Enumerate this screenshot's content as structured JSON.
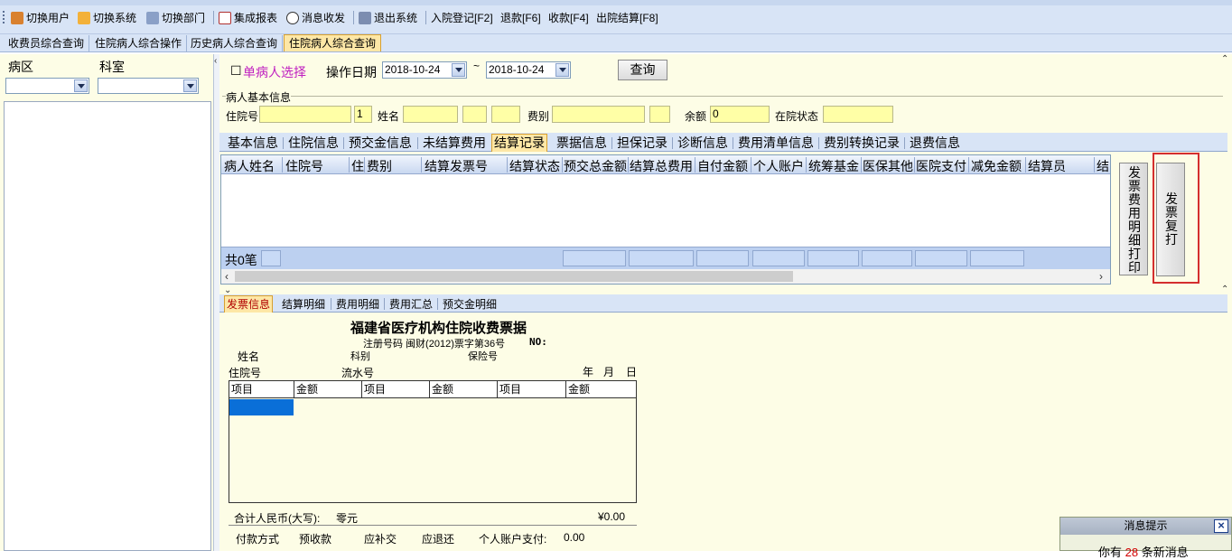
{
  "toolbar": {
    "items": [
      {
        "label": "切换用户",
        "icon": "users-icon"
      },
      {
        "label": "切换系统",
        "icon": "switch-system-icon"
      },
      {
        "label": "切换部门",
        "icon": "department-icon"
      },
      {
        "label": "集成报表",
        "icon": "report-icon"
      },
      {
        "label": "消息收发",
        "icon": "message-icon"
      },
      {
        "label": "退出系统",
        "icon": "exit-icon"
      },
      {
        "label": "入院登记[F2]"
      },
      {
        "label": "退款[F6]"
      },
      {
        "label": "收款[F4]"
      },
      {
        "label": "出院结算[F8]"
      }
    ]
  },
  "top_tabs": [
    "收费员综合查询",
    "住院病人综合操作",
    "历史病人综合查询",
    "住院病人综合查询"
  ],
  "left_panel": {
    "ward_label": "病区",
    "dept_label": "科室",
    "ward_value": "",
    "dept_value": ""
  },
  "query": {
    "single_patient_label": "单病人选择",
    "op_date_label": "操作日期",
    "date_from": "2018-10-24",
    "tilde": "~",
    "date_to": "2018-10-24",
    "query_button": "查询"
  },
  "patient_info": {
    "section_label": "病人基本信息",
    "admission_no_label": "住院号",
    "admission_no_value": "",
    "count_value": "1",
    "name_label": "姓名",
    "fee_type_label": "费别",
    "balance_label": "余额",
    "balance_value": "0",
    "status_label": "在院状态"
  },
  "mid_tabs": [
    "基本信息",
    "住院信息",
    "预交金信息",
    "未结算费用",
    "结算记录",
    "票据信息",
    "担保记录",
    "诊断信息",
    "费用清单信息",
    "费别转换记录",
    "退费信息"
  ],
  "grid": {
    "columns": [
      "病人姓名",
      "住院号",
      "住",
      "费别",
      "结算发票号",
      "结算状态",
      "预交总金额",
      "结算总费用",
      "自付金额",
      "个人账户",
      "统筹基金",
      "医保其他",
      "医院支付",
      "减免金额",
      "结算员",
      "结"
    ],
    "footer_count": "共0笔"
  },
  "side_buttons": {
    "detail_print": "发票费用明细打印",
    "reprint": "发票复打"
  },
  "bottom_tabs": [
    "发票信息",
    "结算明细",
    "费用明细",
    "费用汇总",
    "预交金明细"
  ],
  "receipt": {
    "title": "福建省医疗机构住院收费票据",
    "reg_no": "注册号码 闽财(2012)票字第36号",
    "no_label": "NO:",
    "name_label": "姓名",
    "dept_label": "科别",
    "insurance_label": "保险号",
    "admission_label": "住院号",
    "serial_label": "流水号",
    "year": "年",
    "month": "月",
    "day": "日",
    "table_headers": [
      "项目",
      "金额",
      "项目",
      "金额",
      "项目",
      "金额"
    ],
    "total_label": "合计人民币(大写):",
    "total_value": "零元",
    "total_amount": "¥0.00",
    "pay_method": "付款方式",
    "prepaid": "预收款",
    "supplement": "应补交",
    "refund": "应退还",
    "personal_account_label": "个人账户支付:",
    "personal_account_value": "0.00"
  },
  "notification": {
    "title": "消息提示",
    "body_prefix": "你有",
    "count": "28",
    "body_suffix": "条新消息"
  }
}
